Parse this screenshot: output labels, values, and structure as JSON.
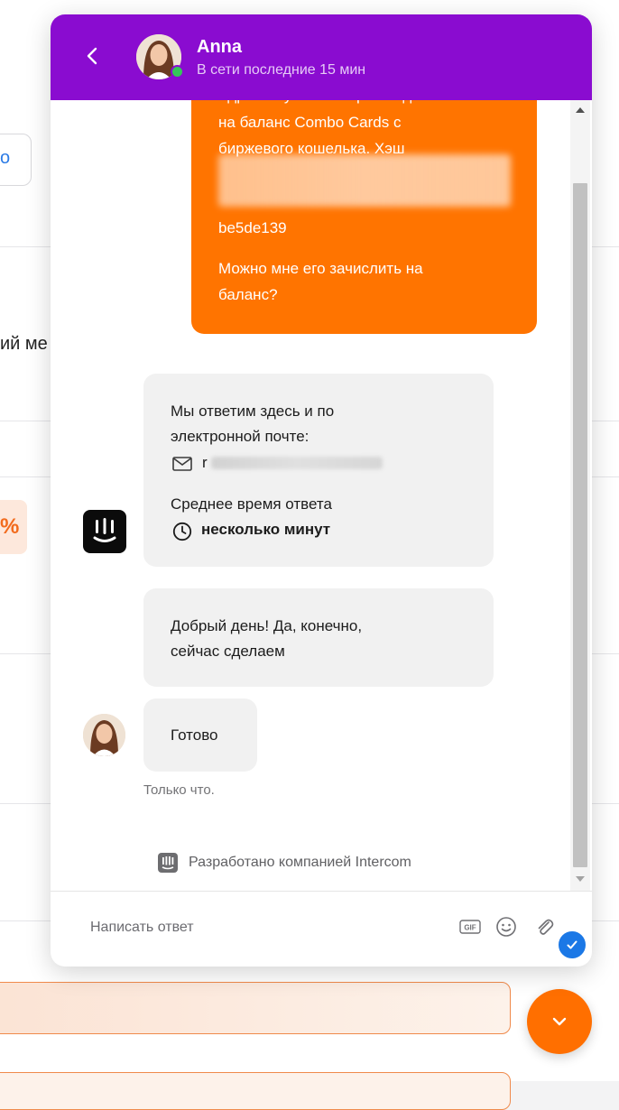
{
  "background": {
    "partial_text": "ий ме",
    "box_char": "о",
    "percent_glyph": "%"
  },
  "header": {
    "name": "Anna",
    "status": "В сети последние 15 мин",
    "accent": "#8a0cd0"
  },
  "messages": {
    "user": {
      "line1": "Здравствуйте. Я перевел деньги",
      "line2": "на баланс Combo Cards с",
      "line3": "биржевого кошелька. Хэш",
      "hash_tail": "be5de139",
      "line4": "Можно мне его зачислить на",
      "line5": "баланс?",
      "color": "#ff7400"
    },
    "bot_card": {
      "line1": "Мы ответим здесь и по",
      "line2": "электронной почте:",
      "email_prefix": "r",
      "avg_label": "Среднее время ответа",
      "avg_value": "несколько минут"
    },
    "agent1": {
      "line1": "Добрый день! Да, конечно,",
      "line2": "сейчас сделаем"
    },
    "agent2": {
      "text": "Готово"
    },
    "timestamp": "Только что."
  },
  "powered_by": "Разработано компанией Intercom",
  "composer": {
    "placeholder": "Написать ответ",
    "gif_label": "GIF"
  }
}
